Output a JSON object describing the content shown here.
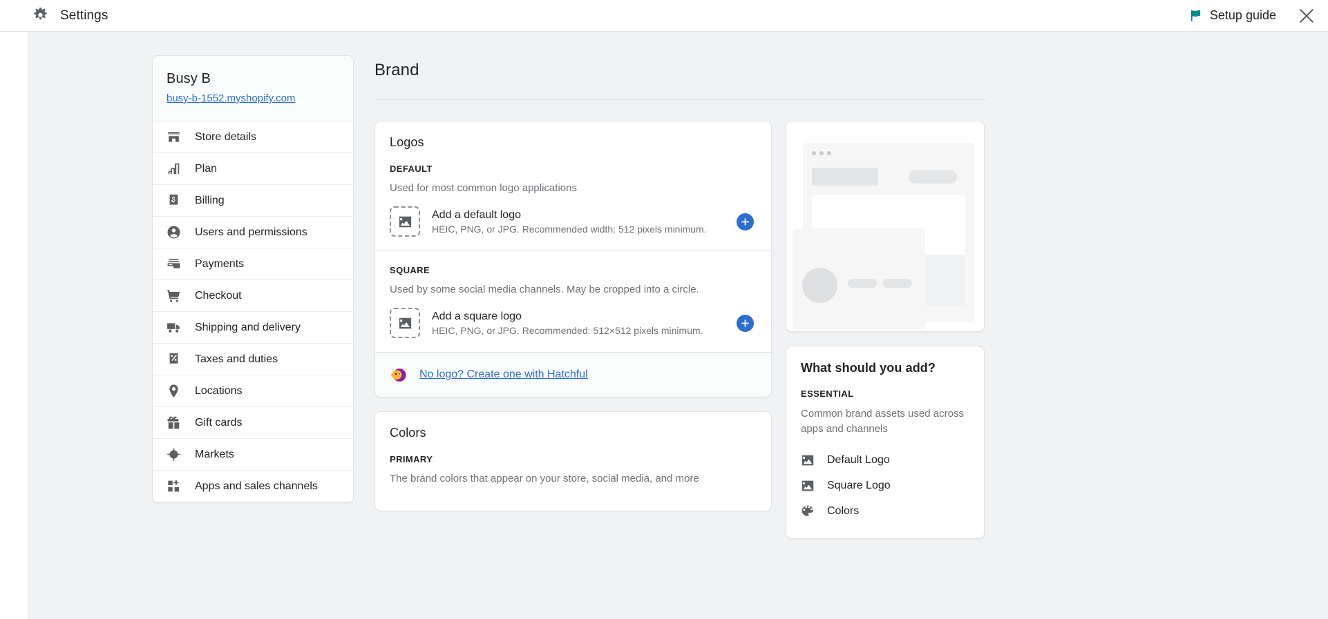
{
  "topbar": {
    "gear_icon": "gear-icon",
    "title": "Settings",
    "setup_guide_label": "Setup guide",
    "flag_icon": "flag-icon",
    "flag_color": "#008b8b",
    "close_icon": "close-icon"
  },
  "sidebar": {
    "store_name": "Busy B",
    "store_url": "busy-b-1552.myshopify.com",
    "items": [
      {
        "label": "Store details",
        "icon": "store-icon"
      },
      {
        "label": "Plan",
        "icon": "plan-icon"
      },
      {
        "label": "Billing",
        "icon": "billing-icon"
      },
      {
        "label": "Users and permissions",
        "icon": "user-icon"
      },
      {
        "label": "Payments",
        "icon": "payments-icon"
      },
      {
        "label": "Checkout",
        "icon": "cart-icon"
      },
      {
        "label": "Shipping and delivery",
        "icon": "truck-icon"
      },
      {
        "label": "Taxes and duties",
        "icon": "percent-receipt-icon"
      },
      {
        "label": "Locations",
        "icon": "location-pin-icon"
      },
      {
        "label": "Gift cards",
        "icon": "gift-icon"
      },
      {
        "label": "Markets",
        "icon": "globe-icon"
      },
      {
        "label": "Apps and sales channels",
        "icon": "apps-plus-icon"
      }
    ]
  },
  "main": {
    "page_title": "Brand",
    "logos_card": {
      "title": "Logos",
      "default_section": {
        "label": "DEFAULT",
        "description": "Used for most common logo applications",
        "upload_title": "Add a default logo",
        "upload_hint": "HEIC, PNG, or JPG. Recommended width: 512 pixels minimum.",
        "add_button_icon": "plus-icon",
        "add_button_color": "#2c6ecb",
        "placeholder_icon": "image-icon"
      },
      "square_section": {
        "label": "SQUARE",
        "description": "Used by some social media channels. May be cropped into a circle.",
        "upload_title": "Add a square logo",
        "upload_hint": "HEIC, PNG, or JPG. Recommended: 512×512 pixels minimum.",
        "add_button_icon": "plus-icon",
        "placeholder_icon": "image-icon"
      },
      "hatchful": {
        "link_text": "No logo? Create one with Hatchful",
        "icon": "hatchful-bird-icon"
      }
    },
    "colors_card": {
      "title": "Colors",
      "primary_label": "PRIMARY",
      "primary_description": "The brand colors that appear on your store, social media, and more"
    }
  },
  "aside": {
    "preview_alt": "brand-preview-illustration",
    "title": "What should you add?",
    "subtitle": "ESSENTIAL",
    "description": "Common brand assets used across apps and channels",
    "items": [
      {
        "label": "Default Logo",
        "icon": "image-icon"
      },
      {
        "label": "Square Logo",
        "icon": "image-icon"
      },
      {
        "label": "Colors",
        "icon": "palette-icon"
      }
    ]
  }
}
